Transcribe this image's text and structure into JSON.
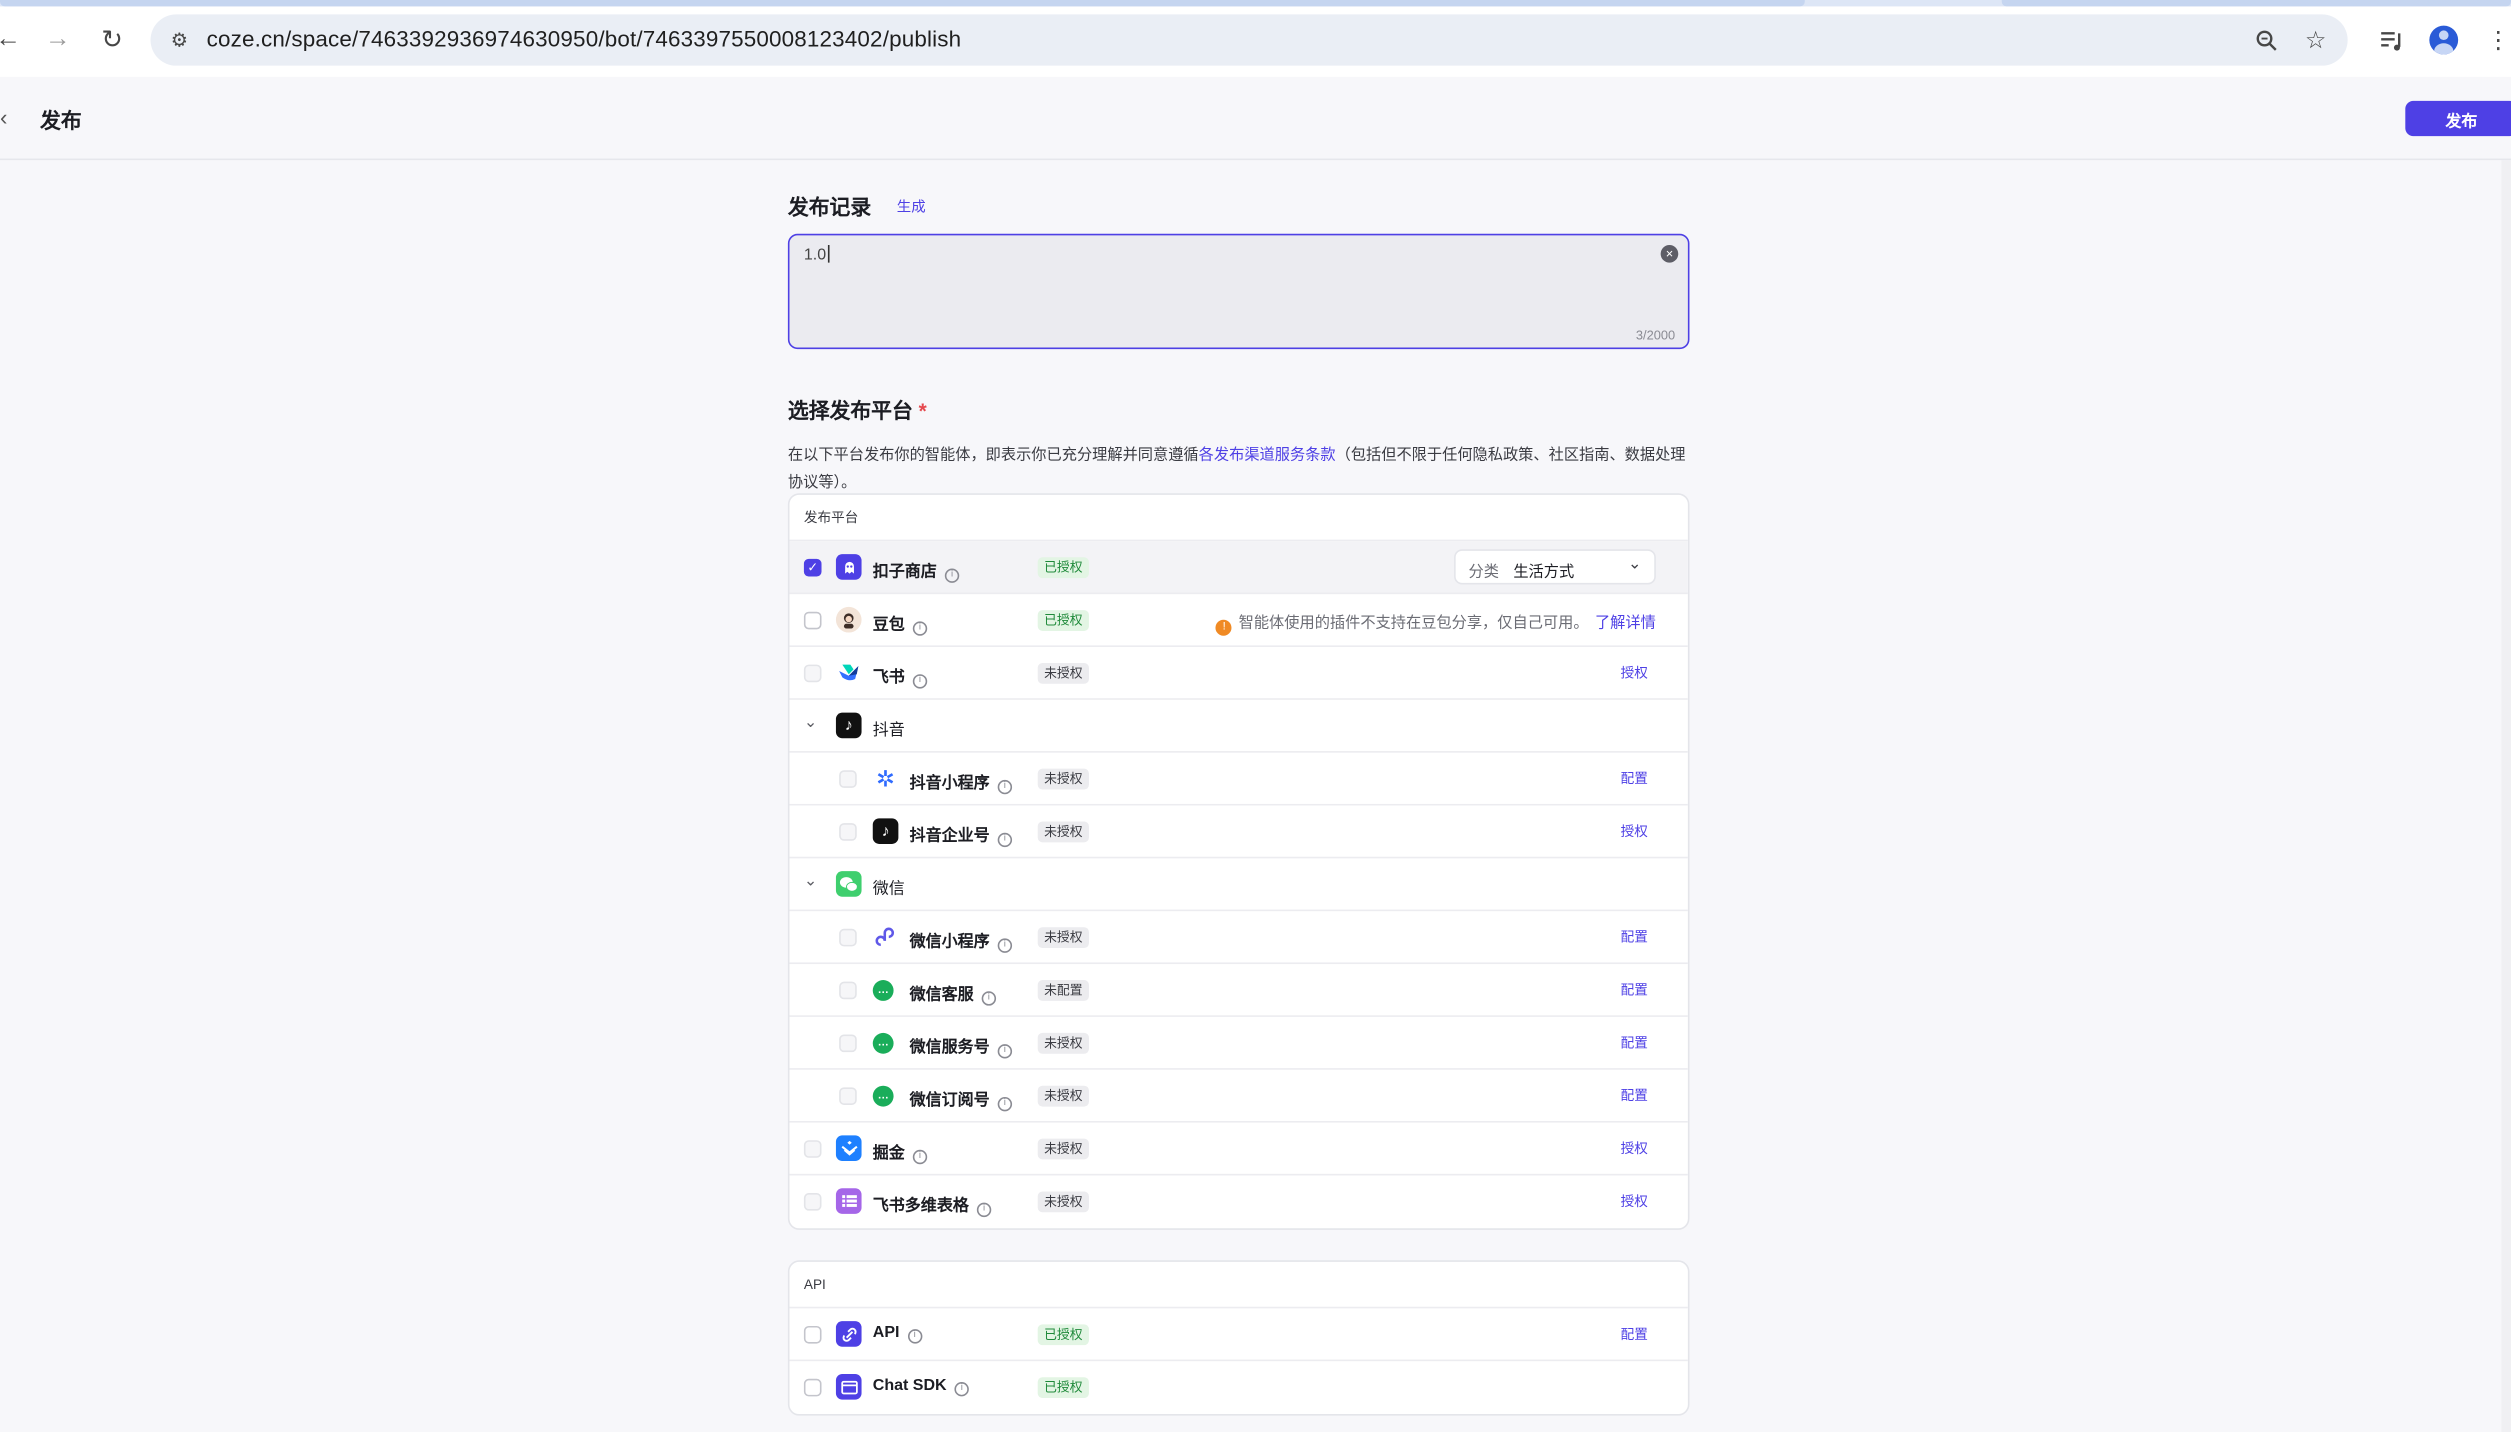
{
  "browser": {
    "url": "coze.cn/space/7463392936974630950/bot/7463397550008123402/publish"
  },
  "header": {
    "title": "发布",
    "publish_label": "发布"
  },
  "release": {
    "title": "发布记录",
    "generate_label": "生成",
    "value": "1.0",
    "counter": "3/2000"
  },
  "platforms": {
    "title": "选择发布平台",
    "required_mark": "*",
    "desc_before": "在以下平台发布你的智能体，即表示你已充分理解并同意遵循",
    "desc_link": "各发布渠道服务条款",
    "desc_after": "（包括但不限于任何隐私政策、社区指南、数据处理协议等）。",
    "card_header": "发布平台",
    "store": {
      "name": "扣子商店",
      "status": "已授权",
      "category_key": "分类",
      "category_value": "生活方式"
    },
    "doubao": {
      "name": "豆包",
      "status": "已授权",
      "warning": "智能体使用的插件不支持在豆包分享，仅自己可用。",
      "warning_link": "了解详情"
    },
    "feishu": {
      "name": "飞书",
      "status": "未授权",
      "action": "授权"
    },
    "douyin_group": {
      "name": "抖音"
    },
    "douyin_mini": {
      "name": "抖音小程序",
      "status": "未授权",
      "action": "配置"
    },
    "douyin_biz": {
      "name": "抖音企业号",
      "status": "未授权",
      "action": "授权"
    },
    "wechat_group": {
      "name": "微信"
    },
    "wechat_mini": {
      "name": "微信小程序",
      "status": "未授权",
      "action": "配置"
    },
    "wechat_cs": {
      "name": "微信客服",
      "status": "未配置",
      "action": "配置"
    },
    "wechat_service": {
      "name": "微信服务号",
      "status": "未授权",
      "action": "配置"
    },
    "wechat_sub": {
      "name": "微信订阅号",
      "status": "未授权",
      "action": "配置"
    },
    "juejin": {
      "name": "掘金",
      "status": "未授权",
      "action": "授权"
    },
    "bitable": {
      "name": "飞书多维表格",
      "status": "未授权",
      "action": "授权"
    }
  },
  "api_section": {
    "card_header": "API",
    "api": {
      "name": "API",
      "status": "已授权",
      "action": "配置"
    },
    "sdk": {
      "name": "Chat SDK",
      "status": "已授权"
    }
  },
  "colors": {
    "accent": "#4e40e5",
    "authorized_bg": "#e3f5e4",
    "authorized_text": "#1f8a3a",
    "warning": "#f08a24"
  }
}
